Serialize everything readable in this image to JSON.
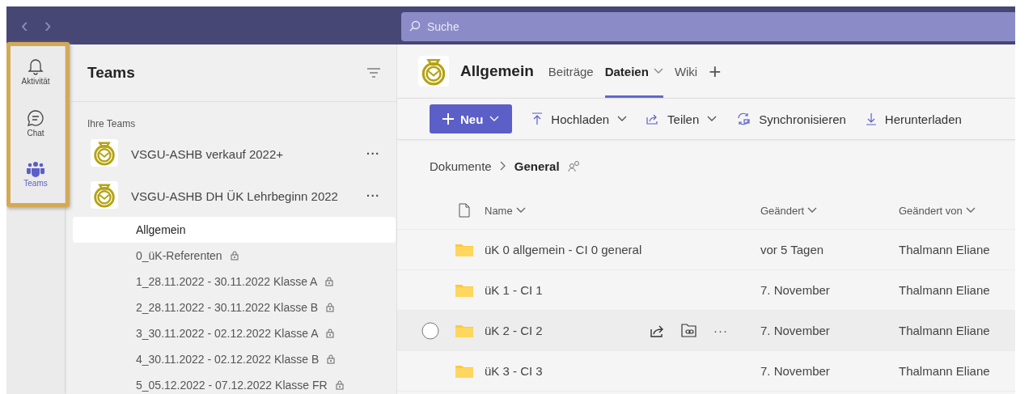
{
  "nav": {
    "back": "‹",
    "forward": "›"
  },
  "search": {
    "placeholder": "Suche"
  },
  "rail": [
    {
      "label": "Aktivität",
      "selected": false
    },
    {
      "label": "Chat",
      "selected": false
    },
    {
      "label": "Teams",
      "selected": true
    }
  ],
  "teams_panel": {
    "title": "Teams",
    "section": "Ihre Teams",
    "teams": [
      {
        "name": "VSGU-ASHB verkauf 2022+",
        "more": "···"
      },
      {
        "name": "VSGU-ASHB DH ÜK Lehrbeginn 2022",
        "more": "···",
        "channels": [
          {
            "name": "Allgemein",
            "private": false,
            "selected": true
          },
          {
            "name": "0_üK-Referenten",
            "private": true,
            "selected": false
          },
          {
            "name": "1_28.11.2022 - 30.11.2022 Klasse A",
            "private": true,
            "selected": false
          },
          {
            "name": "2_28.11.2022 - 30.11.2022 Klasse B",
            "private": true,
            "selected": false
          },
          {
            "name": "3_30.11.2022 - 02.12.2022 Klasse A",
            "private": true,
            "selected": false
          },
          {
            "name": "4_30.11.2022 - 02.12.2022 Klasse B",
            "private": true,
            "selected": false
          },
          {
            "name": "5_05.12.2022 - 07.12.2022 Klasse FR",
            "private": true,
            "selected": false
          }
        ]
      }
    ]
  },
  "channel": {
    "title": "Allgemein",
    "tabs": [
      {
        "label": "Beiträge",
        "selected": false,
        "dropdown": false
      },
      {
        "label": "Dateien",
        "selected": true,
        "dropdown": true
      },
      {
        "label": "Wiki",
        "selected": false,
        "dropdown": false
      }
    ],
    "add_tab": "+"
  },
  "toolbar": [
    {
      "kind": "primary",
      "label": "Neu",
      "dropdown": true
    },
    {
      "kind": "plain",
      "label": "Hochladen",
      "dropdown": true
    },
    {
      "kind": "plain",
      "label": "Teilen",
      "dropdown": true
    },
    {
      "kind": "plain",
      "label": "Synchronisieren",
      "dropdown": false
    },
    {
      "kind": "plain",
      "label": "Herunterladen",
      "dropdown": false
    }
  ],
  "breadcrumb": [
    {
      "label": "Dokumente",
      "current": false
    },
    {
      "label": "General",
      "current": true
    }
  ],
  "table": {
    "columns": [
      "Name",
      "Geändert",
      "Geändert von"
    ],
    "rows": [
      {
        "name": "üK 0 allgemein - CI 0 general",
        "modified": "vor 5 Tagen",
        "modified_by": "Thalmann Eliane",
        "hovered": false
      },
      {
        "name": "üK 1 - CI 1",
        "modified": "7. November",
        "modified_by": "Thalmann Eliane",
        "hovered": false
      },
      {
        "name": "üK 2 - CI 2",
        "modified": "7. November",
        "modified_by": "Thalmann Eliane",
        "hovered": true,
        "more": "···"
      },
      {
        "name": "üK 3 - CI 3",
        "modified": "7. November",
        "modified_by": "Thalmann Eliane",
        "hovered": false
      }
    ]
  }
}
